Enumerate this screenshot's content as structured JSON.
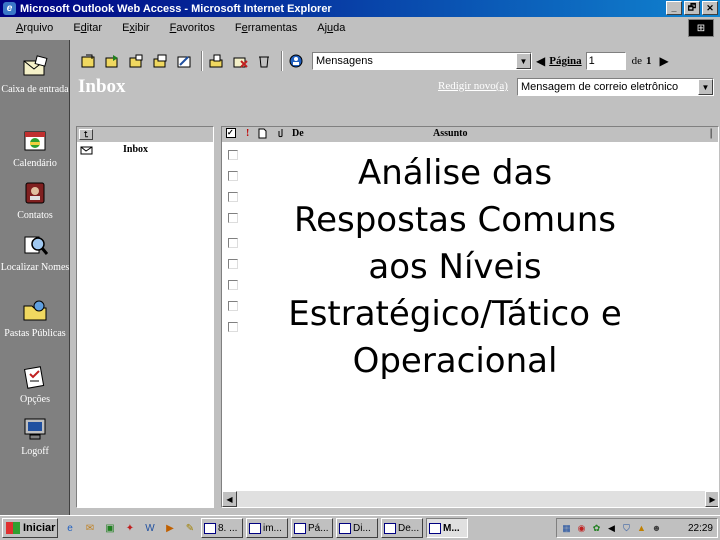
{
  "window": {
    "title": "Microsoft Outlook Web Access - Microsoft Internet Explorer",
    "minimize": "_",
    "maximize": "🗗",
    "close": "✕"
  },
  "menu": [
    {
      "pre": "",
      "u": "A",
      "post": "rquivo"
    },
    {
      "pre": "E",
      "u": "d",
      "post": "itar"
    },
    {
      "pre": "E",
      "u": "x",
      "post": "ibir"
    },
    {
      "pre": "",
      "u": "F",
      "post": "avoritos"
    },
    {
      "pre": "F",
      "u": "e",
      "post": "rramentas"
    },
    {
      "pre": "Aj",
      "u": "u",
      "post": "da"
    }
  ],
  "nav": {
    "items": [
      {
        "label": "Caixa de entrada",
        "icon": "inbox-icon"
      },
      {
        "label": "Calendário",
        "icon": "calendar-icon"
      },
      {
        "label": "Contatos",
        "icon": "contacts-icon"
      },
      {
        "label": "Localizar Nomes",
        "icon": "find-names-icon"
      },
      {
        "label": "Pastas Públicas",
        "icon": "public-folders-icon"
      },
      {
        "label": "Opções",
        "icon": "options-icon"
      },
      {
        "label": "Logoff",
        "icon": "logoff-icon"
      }
    ]
  },
  "toolbar": {
    "folder_view": "Mensagens",
    "page_label": "Página",
    "page_value": "1",
    "of_label": "de",
    "total_pages": "1"
  },
  "folder": {
    "title": "Inbox",
    "compose_link": "Redigir novo(a)",
    "compose_type": "Mensagem de correio eletrônico"
  },
  "tree": {
    "items": [
      {
        "label": ""
      },
      {
        "label": "Inbox"
      }
    ]
  },
  "list": {
    "columns": {
      "importance": "!",
      "from": "De",
      "subject": "Assunto"
    },
    "row_count": 9
  },
  "overlay": {
    "line1": "Análise das",
    "line2": "Respostas Comuns",
    "line3": "aos Níveis",
    "line4": "Estratégico/Tático e",
    "line5": "Operacional"
  },
  "taskbar": {
    "start_label": "Iniciar",
    "tasks": [
      "8. ...",
      "im...",
      "Pá...",
      "Di...",
      "De...",
      "M..."
    ],
    "clock": "22:29"
  }
}
